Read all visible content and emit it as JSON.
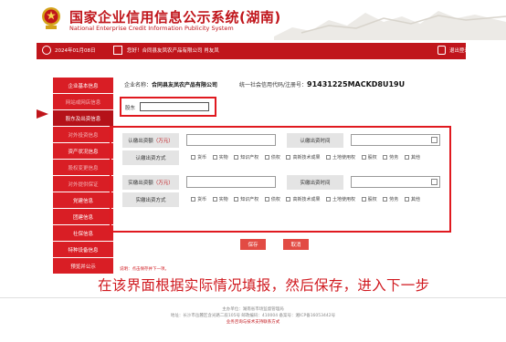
{
  "header": {
    "title": "国家企业信用信息公示系统(湖南)",
    "subtitle": "National Enterprise Credit Information Publicity System"
  },
  "topbar": {
    "date": "2024年01月08日",
    "user": "您好！合同县友凤农产品有限公司  肖友凤",
    "logout": "退出登录"
  },
  "sidebar": {
    "items": [
      {
        "label": "企业基本信息",
        "state": "normal"
      },
      {
        "label": "网站或网店信息",
        "state": "light"
      },
      {
        "label": "股东及出资信息",
        "state": "active"
      },
      {
        "label": "对外投资信息",
        "state": "light"
      },
      {
        "label": "资产状况信息",
        "state": "normal"
      },
      {
        "label": "股权变更信息",
        "state": "light"
      },
      {
        "label": "对外提供保证",
        "state": "light"
      },
      {
        "label": "党建信息",
        "state": "normal"
      },
      {
        "label": "团建信息",
        "state": "normal"
      },
      {
        "label": "社保信息",
        "state": "normal"
      },
      {
        "label": "特种设备信息",
        "state": "normal"
      },
      {
        "label": "预览并公示",
        "state": "normal"
      }
    ]
  },
  "company": {
    "name_label": "企业名称：",
    "name": "合同县友凤农产品有限公司",
    "credit_label": "统一社会信用代码/注册号：",
    "credit_code": "91431225MACKD8U19U"
  },
  "shareholder": {
    "label": "股东",
    "value": ""
  },
  "subscribed": {
    "amount_label": "认缴出资额",
    "amount_unit": "（万元）",
    "amount_value": "",
    "date_label": "认缴出资时间",
    "date_value": "",
    "method_label": "认缴出资方式"
  },
  "paid": {
    "amount_label": "实缴出资额",
    "amount_unit": "（万元）",
    "amount_value": "",
    "date_label": "实缴出资时间",
    "date_value": "",
    "method_label": "实缴出资方式"
  },
  "contribution_options": [
    "货币",
    "实物",
    "知识产权",
    "债权",
    "高新技术成果",
    "土地使用权",
    "股权",
    "劳务",
    "其他"
  ],
  "buttons": {
    "save": "保存",
    "cancel": "取消"
  },
  "note": "说明：点击保存并下一项。",
  "instruction": "在该界面根据实际情况填报，然后保存，进入下一步",
  "footer": {
    "line1": "主办单位：湖南省市场监督管理局",
    "line2": "地址：长沙市岳麓区含光路二段105号 邮政编码：410004 备案号：湘ICP备16053442号",
    "line3": "业务咨询与技术支持联系方式"
  },
  "colors": {
    "brand_red": "#c0151b",
    "sidebar_red": "#d91e25",
    "highlight_border": "#e0191f",
    "button_red": "#e24b44",
    "label_gray": "#e4e4e4"
  },
  "icons": [
    "national-emblem-icon",
    "great-wall-art",
    "clock-icon",
    "book-icon",
    "logout-icon",
    "calendar-icon",
    "arrow-marker-icon"
  ]
}
